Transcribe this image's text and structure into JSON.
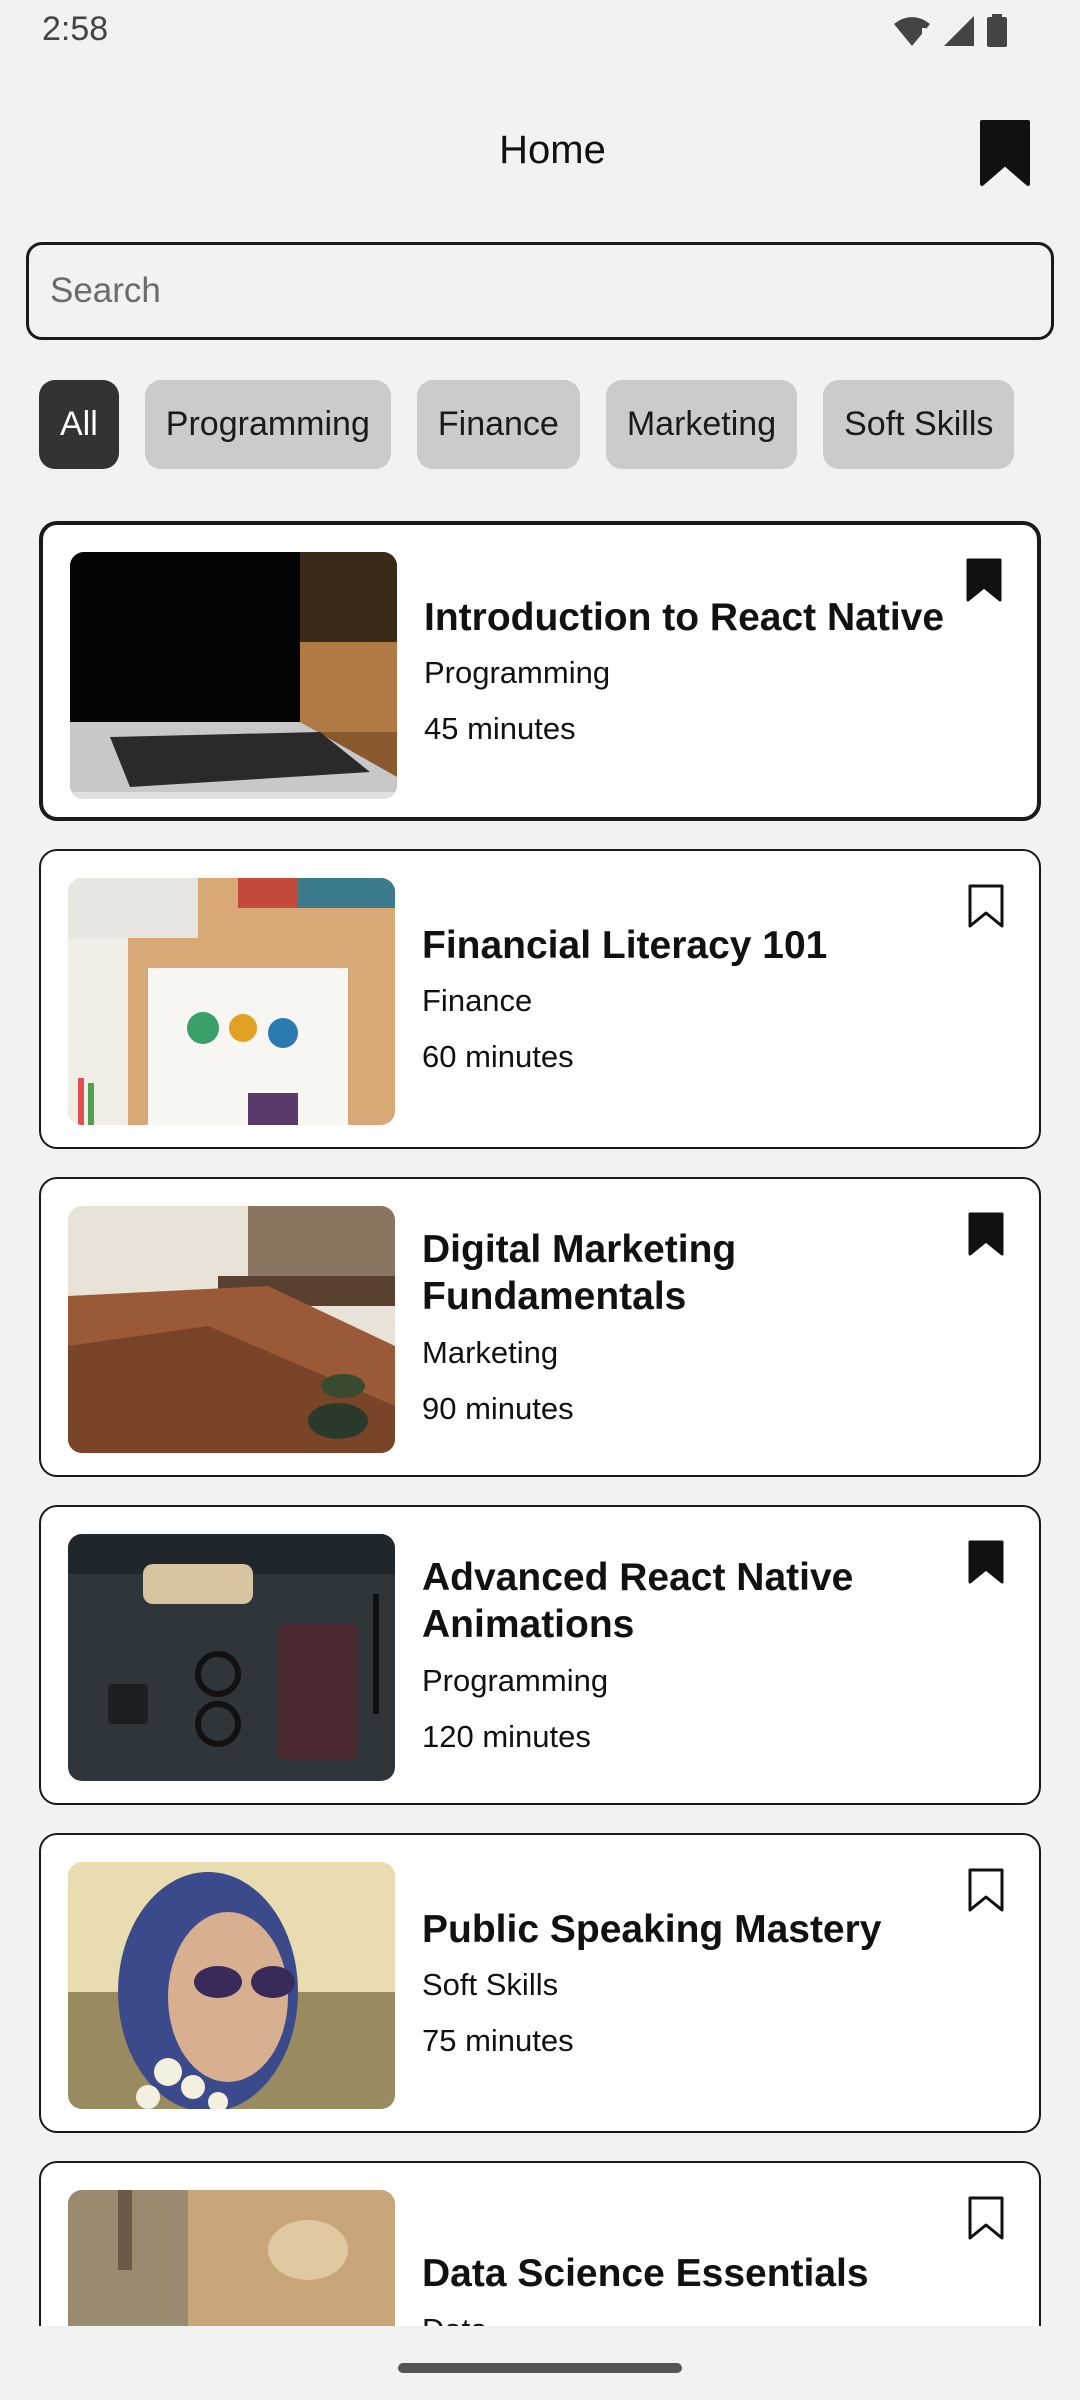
{
  "status_bar": {
    "time": "2:58",
    "icons": [
      "wifi-icon",
      "signal-icon",
      "battery-icon"
    ]
  },
  "header": {
    "title": "Home",
    "bookmark_icon": "bookmark-filled-icon"
  },
  "search": {
    "placeholder": "Search",
    "value": ""
  },
  "filters": {
    "chips": [
      "All",
      "Programming",
      "Finance",
      "Marketing",
      "Soft Skills"
    ],
    "selected": "All",
    "active_color": "#333333",
    "inactive_color": "#cbcbcb"
  },
  "courses": [
    {
      "title": "Introduction to React Native",
      "category": "Programming",
      "duration": "45 minutes",
      "bookmarked": true,
      "image": "laptop-photo"
    },
    {
      "title": "Financial Literacy 101",
      "category": "Finance",
      "duration": "60 minutes",
      "bookmarked": false,
      "image": "desk-papers-photo"
    },
    {
      "title": "Digital Marketing Fundamentals",
      "category": "Marketing",
      "duration": "90 minutes",
      "bookmarked": true,
      "image": "cafe-table-photo"
    },
    {
      "title": "Advanced React Native Animations",
      "category": "Programming",
      "duration": "120 minutes",
      "bookmarked": true,
      "image": "dark-desk-photo"
    },
    {
      "title": "Public Speaking Mastery",
      "category": "Soft Skills",
      "duration": "75 minutes",
      "bookmarked": false,
      "image": "woman-sunglasses-photo"
    },
    {
      "title": "Data Science Essentials",
      "category": "Data",
      "duration": "",
      "bookmarked": false,
      "image": "blurred-desk-photo"
    }
  ]
}
